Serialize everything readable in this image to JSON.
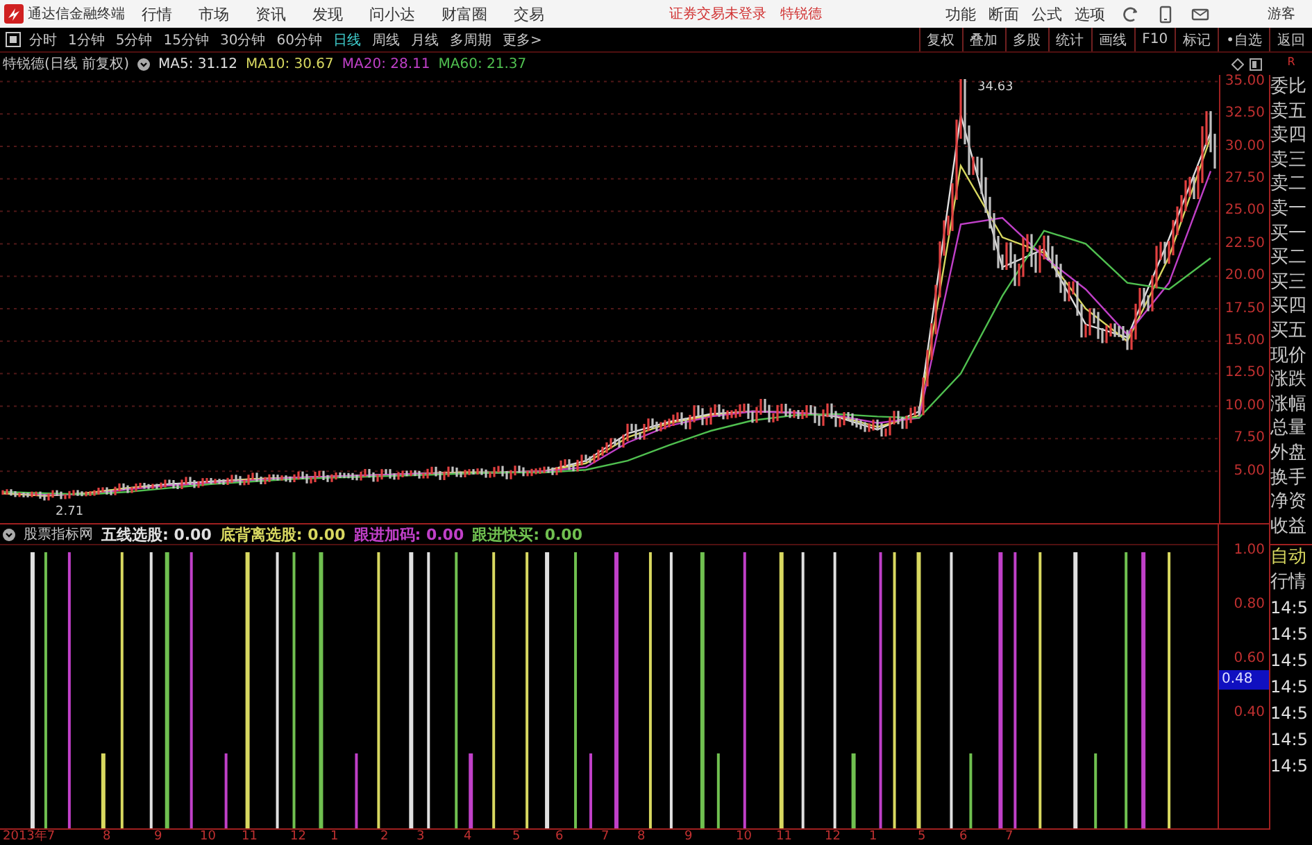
{
  "app": {
    "title": "通达信金融终端",
    "menu": [
      "行情",
      "市场",
      "资讯",
      "发现",
      "问小达",
      "财富圈",
      "交易"
    ],
    "login_notice": "证券交易未登录",
    "stock_name": "特锐德",
    "right_menu": [
      "功能",
      "断面",
      "公式",
      "选项"
    ],
    "user": "游客"
  },
  "periods": [
    {
      "label": "分时",
      "selected": false
    },
    {
      "label": "1分钟",
      "selected": false
    },
    {
      "label": "5分钟",
      "selected": false
    },
    {
      "label": "15分钟",
      "selected": false
    },
    {
      "label": "30分钟",
      "selected": false
    },
    {
      "label": "60分钟",
      "selected": false
    },
    {
      "label": "日线",
      "selected": true
    },
    {
      "label": "周线",
      "selected": false
    },
    {
      "label": "月线",
      "selected": false
    },
    {
      "label": "多周期",
      "selected": false
    },
    {
      "label": "更多>",
      "selected": false
    }
  ],
  "toolbar_buttons": [
    "复权",
    "叠加",
    "多股",
    "统计",
    "画线",
    "F10",
    "标记",
    "•自选",
    "返回"
  ],
  "price_panel": {
    "title": "特锐德(日线 前复权)",
    "indicators": [
      {
        "label": "MA5: 31.12",
        "color": "#e0e0e0"
      },
      {
        "label": "MA10: 30.67",
        "color": "#d8d860"
      },
      {
        "label": "MA20: 28.11",
        "color": "#c040c8"
      },
      {
        "label": "MA60: 21.37",
        "color": "#50c050"
      }
    ],
    "annotations": [
      "34.63",
      "2.71"
    ],
    "chart_data": {
      "type": "line",
      "grid": true,
      "categories": [
        null,
        null,
        null,
        null,
        null,
        null,
        null,
        null,
        null,
        null,
        null,
        null,
        null,
        null,
        null,
        null,
        null,
        null,
        null,
        null,
        null,
        null,
        null,
        null,
        null,
        null,
        null,
        null,
        null,
        null
      ],
      "ylim": [
        1,
        35.5
      ],
      "yticks": [
        {
          "value": 35,
          "label": "35.00"
        },
        {
          "value": 32.5,
          "label": "32.50"
        },
        {
          "value": 30,
          "label": "30.00"
        },
        {
          "value": 27.5,
          "label": "27.50"
        },
        {
          "value": 25,
          "label": "25.00"
        },
        {
          "value": 22.5,
          "label": "22.50"
        },
        {
          "value": 20,
          "label": "20.00"
        },
        {
          "value": 17.5,
          "label": "17.50"
        },
        {
          "value": 15,
          "label": "15.00"
        },
        {
          "value": 12.5,
          "label": "12.50"
        },
        {
          "value": 10,
          "label": "10.00"
        },
        {
          "value": 7.5,
          "label": "7.50"
        },
        {
          "value": 5,
          "label": "5.00"
        }
      ],
      "series": [
        {
          "color": "#e0e0e0",
          "values": [
            3.3,
            3.1,
            3.3,
            3.7,
            4.0,
            4.2,
            4.4,
            4.5,
            4.6,
            4.7,
            4.8,
            4.9,
            4.9,
            5.0,
            5.8,
            7.9,
            8.8,
            9.4,
            9.6,
            9.5,
            9.2,
            8.2,
            9.6,
            32.4,
            20.7,
            22.1,
            16.3,
            15.3,
            22.9,
            31.1
          ]
        },
        {
          "color": "#d8d860",
          "values": [
            3.3,
            3.1,
            3.3,
            3.7,
            3.9,
            4.1,
            4.4,
            4.5,
            4.6,
            4.7,
            4.8,
            4.9,
            4.9,
            5.0,
            5.6,
            7.6,
            8.7,
            9.3,
            9.6,
            9.5,
            9.3,
            8.4,
            9.3,
            28.5,
            23.0,
            21.8,
            17.5,
            15.0,
            21.5,
            30.7
          ]
        },
        {
          "color": "#c040c8",
          "values": [
            3.4,
            3.2,
            3.2,
            3.6,
            3.9,
            4.1,
            4.3,
            4.5,
            4.6,
            4.7,
            4.8,
            4.8,
            4.9,
            5.0,
            5.3,
            7.2,
            8.5,
            9.2,
            9.6,
            9.5,
            9.3,
            8.7,
            9.1,
            24.0,
            24.5,
            21.5,
            19.0,
            15.5,
            19.5,
            28.1
          ]
        },
        {
          "color": "#50c050",
          "values": [
            3.4,
            3.3,
            3.2,
            3.4,
            3.7,
            4.0,
            4.2,
            4.4,
            4.5,
            4.6,
            4.7,
            4.8,
            4.9,
            4.9,
            5.1,
            5.8,
            7.0,
            8.1,
            8.9,
            9.3,
            9.4,
            9.2,
            9.1,
            12.5,
            18.5,
            23.5,
            22.5,
            19.5,
            19.0,
            21.4
          ]
        }
      ]
    }
  },
  "indicator_panel": {
    "title": "股票指标网",
    "indicators": [
      {
        "label": "五线选股: 0.00",
        "color": "#e0e0e0"
      },
      {
        "label": "底背离选股: 0.00",
        "color": "#d8d860"
      },
      {
        "label": "跟进加码: 0.00",
        "color": "#c040c8"
      },
      {
        "label": "跟进快买: 0.00",
        "color": "#70c050"
      }
    ],
    "axis_labels": [
      "1.00",
      "0.80",
      "0.60",
      "0.40"
    ],
    "current_value": "0.48"
  },
  "x_axis_labels": [
    "2013年7",
    "8",
    "9",
    "10",
    "11",
    "12",
    "1",
    "2",
    "3",
    "4",
    "5",
    "6",
    "7",
    "8",
    "9",
    "10",
    "11",
    "12",
    "1",
    "5",
    "6",
    "7"
  ],
  "quote_panel": {
    "marker": "R",
    "labels": [
      "委比",
      "卖五",
      "卖四",
      "卖三",
      "卖二",
      "卖一",
      "买一",
      "买二",
      "买三",
      "买四",
      "买五",
      "现价",
      "涨跌",
      "涨幅",
      "总量",
      "外盘",
      "换手",
      "净资",
      "收益"
    ],
    "auto_label": "自动",
    "market_label": "行情",
    "times": [
      "14:5",
      "14:5",
      "14:5",
      "14:5",
      "14:5",
      "14:5",
      "14:5"
    ]
  }
}
